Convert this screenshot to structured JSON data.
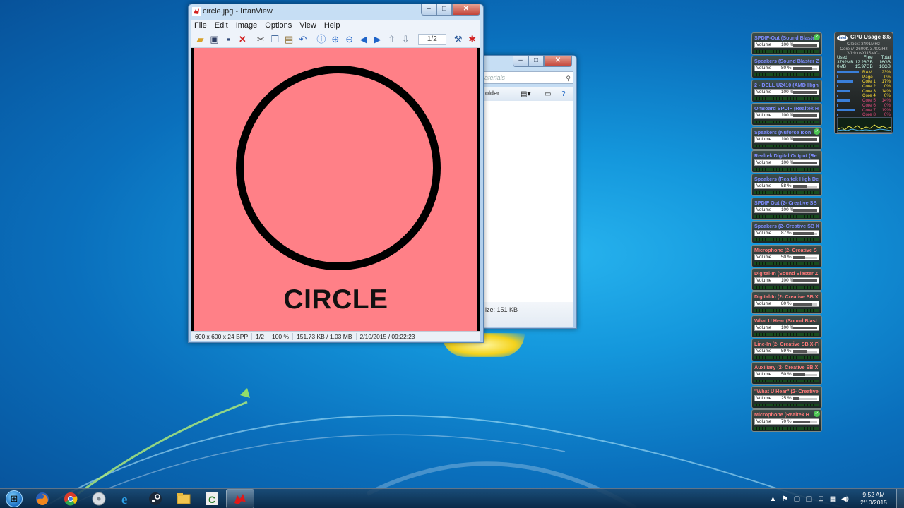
{
  "irfanview": {
    "title": "circle.jpg - IrfanView",
    "menu": [
      "File",
      "Edit",
      "Image",
      "Options",
      "View",
      "Help"
    ],
    "page_counter": "1/2",
    "image_caption": "CIRCLE",
    "image_bg": "#ff8087",
    "status": [
      "600 x 600 x 24 BPP",
      "1/2",
      "100 %",
      "151.73 KB / 1.03 MB",
      "2/10/2015 / 09:22:23"
    ]
  },
  "explorer": {
    "search_placeholder": "aterials",
    "toolbar_label": "older",
    "detail_text": "ize: 151 KB"
  },
  "window_buttons": {
    "min": "–",
    "max": "□",
    "close": "✕"
  },
  "gadgets": [
    {
      "name": "SPDIF-Out (Sound Blaste",
      "color": "#7f8cff",
      "volume": "100 %",
      "level": 100,
      "default": true
    },
    {
      "name": "Speakers (Sound Blaster Z",
      "color": "#7f8cff",
      "volume": "80 %",
      "level": 80,
      "default": false
    },
    {
      "name": "2 - DELL U2410 (AMD High",
      "color": "#7f8cff",
      "volume": "100 %",
      "level": 100,
      "default": false
    },
    {
      "name": "OnBoard SPDIF (Realtek H",
      "color": "#7f8cff",
      "volume": "100 %",
      "level": 100,
      "default": false
    },
    {
      "name": "Speakers (Nuforce Icon",
      "color": "#7f8cff",
      "volume": "100 %",
      "level": 100,
      "default": true
    },
    {
      "name": "Realtek Digital Output (Re",
      "color": "#7f8cff",
      "volume": "100 %",
      "level": 100,
      "default": false
    },
    {
      "name": "Speakers (Realtek High De",
      "color": "#7f8cff",
      "volume": "58 %",
      "level": 58,
      "default": false
    },
    {
      "name": "SPDIF Out (2- Creative SB",
      "color": "#7f8cff",
      "volume": "100 %",
      "level": 100,
      "default": false
    },
    {
      "name": "Speakers (2- Creative SB X",
      "color": "#7f8cff",
      "volume": "87 %",
      "level": 87,
      "default": false
    },
    {
      "name": "Microphone (2- Creative S",
      "color": "#ff7a7a",
      "volume": "50 %",
      "level": 50,
      "default": false
    },
    {
      "name": "Digital-In (Sound Blaster Z",
      "color": "#ff7a7a",
      "volume": "100 %",
      "level": 100,
      "default": false
    },
    {
      "name": "Digital-In (2- Creative SB X",
      "color": "#ff7a7a",
      "volume": "80 %",
      "level": 80,
      "default": false
    },
    {
      "name": "What U Hear (Sound Blast",
      "color": "#ff7a7a",
      "volume": "100 %",
      "level": 100,
      "default": false
    },
    {
      "name": "Line-In (2- Creative SB X-Fi",
      "color": "#ff7a7a",
      "volume": "59 %",
      "level": 59,
      "default": false
    },
    {
      "name": "Auxiliary (2- Creative SB X",
      "color": "#ff7a7a",
      "volume": "50 %",
      "level": 50,
      "default": false
    },
    {
      "name": "\"What U Hear\" (2- Creative",
      "color": "#ff7a7a",
      "volume": "25 %",
      "level": 25,
      "default": false
    },
    {
      "name": "Microphone (Realtek H",
      "color": "#ff7a7a",
      "volume": "70 %",
      "level": 70,
      "default": true
    }
  ],
  "gadget_volume_label": "Volume",
  "cpu": {
    "title": "CPU Usage",
    "percent": "8%",
    "clock": "Clock: 3401MHz",
    "model": "Core i7-2600K 3.40GHz",
    "host": "ViciousXUSMC-",
    "logo": "intel",
    "mem_header": [
      "Used",
      "Free",
      "Total"
    ],
    "mem_rows": [
      [
        "3792MB",
        "12.26GB",
        "16GB"
      ],
      [
        "0MB",
        "15.97GB",
        "16GB"
      ]
    ],
    "cores": [
      {
        "label": "RAM",
        "value": "23%",
        "level": 23
      },
      {
        "label": "Page",
        "value": "0%",
        "level": 0
      },
      {
        "label": "Core 1",
        "value": "17%",
        "level": 17
      },
      {
        "label": "Core 2",
        "value": "0%",
        "level": 0
      },
      {
        "label": "Core 3",
        "value": "14%",
        "level": 14
      },
      {
        "label": "Core 4",
        "value": "0%",
        "level": 0
      },
      {
        "label": "Core 5",
        "value": "14%",
        "level": 14
      },
      {
        "label": "Core 6",
        "value": "0%",
        "level": 0
      },
      {
        "label": "Core 7",
        "value": "19%",
        "level": 19
      },
      {
        "label": "Core 8",
        "value": "0%",
        "level": 0
      }
    ]
  },
  "taskbar": {
    "items": [
      "windows-explorer",
      "firefox",
      "chrome",
      "disc",
      "internet-explorer",
      "steam",
      "folder",
      "cpu-z",
      "irfanview"
    ],
    "time": "9:52 AM",
    "date": "2/10/2015"
  }
}
